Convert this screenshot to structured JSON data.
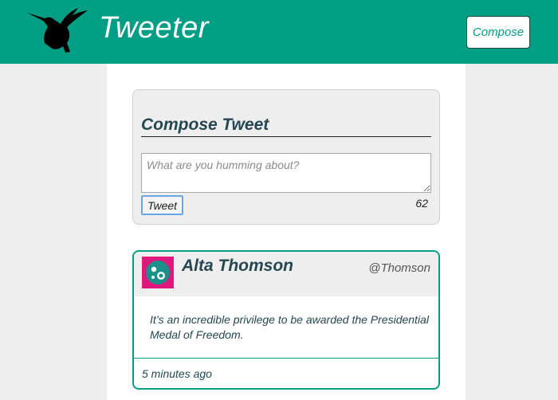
{
  "navbar": {
    "logo_icon": "hummingbird-icon",
    "brand": "Tweeter",
    "compose_label": "Compose",
    "color": "#009e85"
  },
  "compose": {
    "title": "Compose Tweet",
    "placeholder": "What are you humming about?",
    "value": "",
    "tweet_label": "Tweet",
    "counter": "62"
  },
  "tweets": [
    {
      "avatar_icon": "avatar-icon",
      "name": "Alta Thomson",
      "handle": "@Thomson",
      "text": "It’s an incredible privilege to be awarded the Presidential Medal of Freedom.",
      "time": "5 minutes ago"
    }
  ]
}
